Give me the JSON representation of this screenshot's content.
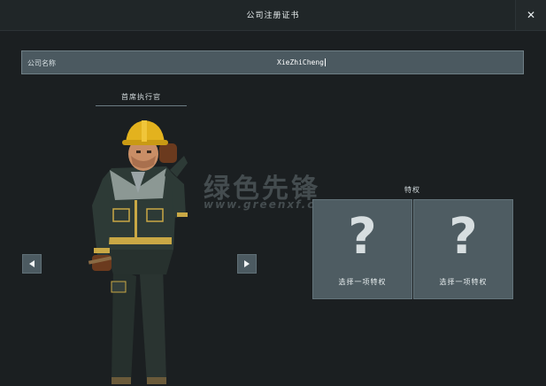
{
  "window": {
    "title": "公司注册证书",
    "close_symbol": "✕"
  },
  "company_name": {
    "label": "公司名称",
    "value": "XieZhiCheng"
  },
  "ceo": {
    "label": "首席执行官",
    "prev_icon": "triangle-left-icon",
    "next_icon": "triangle-right-icon"
  },
  "perks": {
    "label": "特权",
    "slots": [
      {
        "symbol": "?",
        "text": "选择一项特权"
      },
      {
        "symbol": "?",
        "text": "选择一项特权"
      }
    ]
  },
  "watermark": {
    "chinese": "绿色先锋",
    "url": "www.greenxf.com"
  },
  "colors": {
    "background": "#1b1f21",
    "panel": "#4e5c62",
    "input": "#4b5960",
    "helmet": "#e3b21e",
    "uniform": "#2d3a36",
    "trim": "#c9a845"
  }
}
